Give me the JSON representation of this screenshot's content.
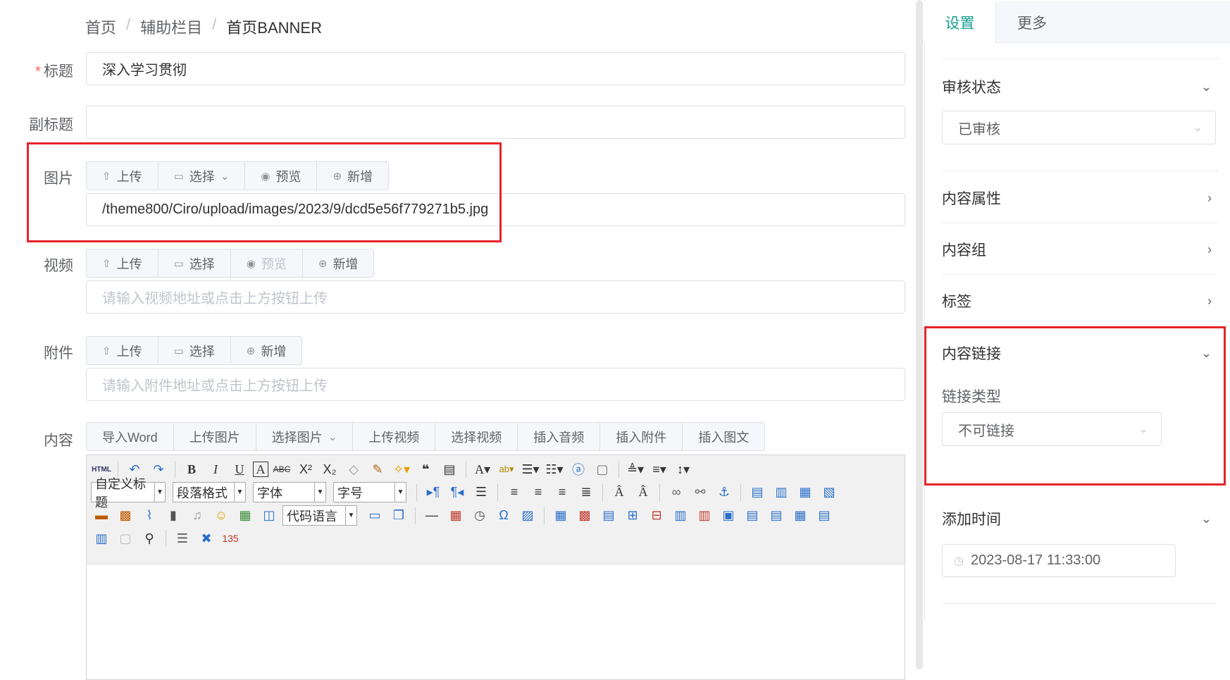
{
  "breadcrumb": [
    "首页",
    "辅助栏目",
    "首页BANNER"
  ],
  "form": {
    "title_label": "标题",
    "title_value": "深入学习贯彻",
    "subtitle_label": "副标题",
    "subtitle_value": "",
    "image_label": "图片",
    "image_buttons": [
      "上传",
      "选择",
      "预览",
      "新增"
    ],
    "image_value": "/theme800/Ciro/upload/images/2023/9/dcd5e56f779271b5.jpg",
    "video_label": "视频",
    "video_buttons": [
      "上传",
      "选择",
      "预览",
      "新增"
    ],
    "video_placeholder": "请输入视频地址或点击上方按钮上传",
    "attach_label": "附件",
    "attach_buttons": [
      "上传",
      "选择",
      "新增"
    ],
    "attach_placeholder": "请输入附件地址或点击上方按钮上传",
    "content_label": "内容",
    "content_buttons": [
      "导入Word",
      "上传图片",
      "选择图片",
      "上传视频",
      "选择视频",
      "插入音频",
      "插入附件",
      "插入图文"
    ]
  },
  "editor": {
    "selects": [
      "自定义标题",
      "段落格式",
      "字体",
      "字号",
      "代码语言"
    ]
  },
  "panel": {
    "tabs": [
      "设置",
      "更多"
    ],
    "audit_title": "审核状态",
    "audit_value": "已审核",
    "attr_title": "内容属性",
    "group_title": "内容组",
    "tag_title": "标签",
    "link_title": "内容链接",
    "link_type_label": "链接类型",
    "link_type_value": "不可链接",
    "time_title": "添加时间",
    "time_value": "2023-08-17 11:33:00"
  },
  "colors": {
    "accent": "#1aa093",
    "highlight": "#e5242b"
  }
}
